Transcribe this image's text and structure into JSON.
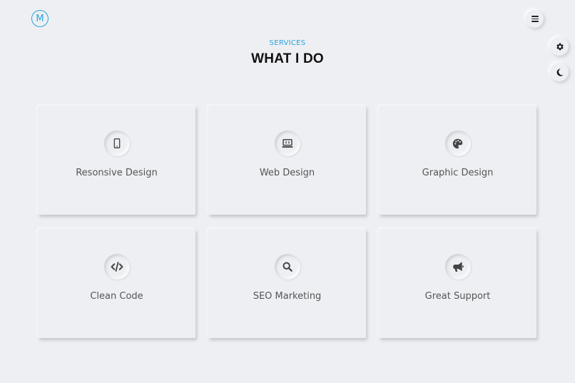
{
  "brand": {
    "logo_letter": "M"
  },
  "header": {
    "kicker": "SERVICES",
    "title": "WHAT I DO"
  },
  "controls": {
    "menu_icon": "hamburger-icon",
    "settings_icon": "gear-icon",
    "theme_icon": "moon-icon"
  },
  "colors": {
    "accent": "#2aa3dc",
    "background": "#eeeff3",
    "title": "#111111",
    "label": "#555555"
  },
  "services": [
    {
      "label": "Resonsive Design",
      "icon": "mobile-phone-icon"
    },
    {
      "label": "Web Design",
      "icon": "laptop-code-icon"
    },
    {
      "label": "Graphic Design",
      "icon": "palette-icon"
    },
    {
      "label": "Clean Code",
      "icon": "code-icon"
    },
    {
      "label": "SEO Marketing",
      "icon": "search-icon"
    },
    {
      "label": "Great Support",
      "icon": "megaphone-icon"
    }
  ]
}
